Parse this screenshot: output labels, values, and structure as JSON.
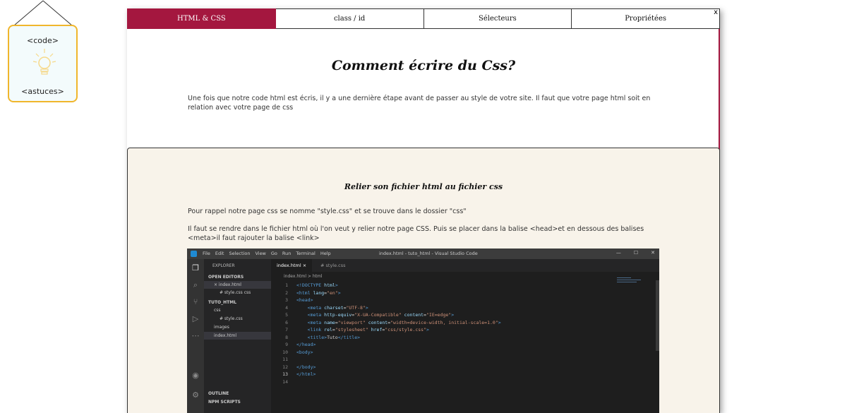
{
  "sign": {
    "top_text": "<code>",
    "bottom_text": "<astuces>"
  },
  "tabs": [
    {
      "label": "HTML & CSS",
      "active": true
    },
    {
      "label": "class / id",
      "active": false
    },
    {
      "label": "Sélecteurs",
      "active": false
    },
    {
      "label": "Propriétées",
      "active": false
    }
  ],
  "close_label": "x",
  "main": {
    "title": "Comment écrire du Css?",
    "intro": "Une fois que notre code html est écris, il y a une dernière étape avant de passer au style de votre site. Il faut que votre page html soit en relation avec votre page de css"
  },
  "panel": {
    "subtitle": "Relier son fichier html au fichier css",
    "p1": "Pour rappel notre page css se nomme \"style.css\" et se trouve dans le dossier \"css\"",
    "p2": "Il faut se rendre dans le fichier html où l'on veut y relier notre page CSS. Puis se placer dans la balise <head>et en dessous des balises <meta>il faut rajouter la balise <link>"
  },
  "vscode": {
    "menu": [
      "File",
      "Edit",
      "Selection",
      "View",
      "Go",
      "Run",
      "Terminal",
      "Help"
    ],
    "window_title": "index.html - tuto_html - Visual Studio Code",
    "explorer_label": "EXPLORER",
    "sidebar": [
      "OPEN EDITORS",
      "× index.html",
      "# style.css  css",
      "TUTO_HTML",
      "css",
      "# style.css",
      "images",
      "index.html"
    ],
    "outline": "OUTLINE",
    "npm": "NPM SCRIPTS",
    "tabs": [
      "index.html ×",
      "# style.css"
    ],
    "breadcrumb": "index.html > html",
    "line_numbers": [
      "1",
      "2",
      "3",
      "4",
      "5",
      "6",
      "7",
      "8",
      "9",
      "10",
      "11",
      "12",
      "13",
      "14"
    ]
  },
  "colors": {
    "accent": "#a4173f",
    "panel_bg": "#f8f3ea",
    "sign_border": "#f0b62c"
  }
}
